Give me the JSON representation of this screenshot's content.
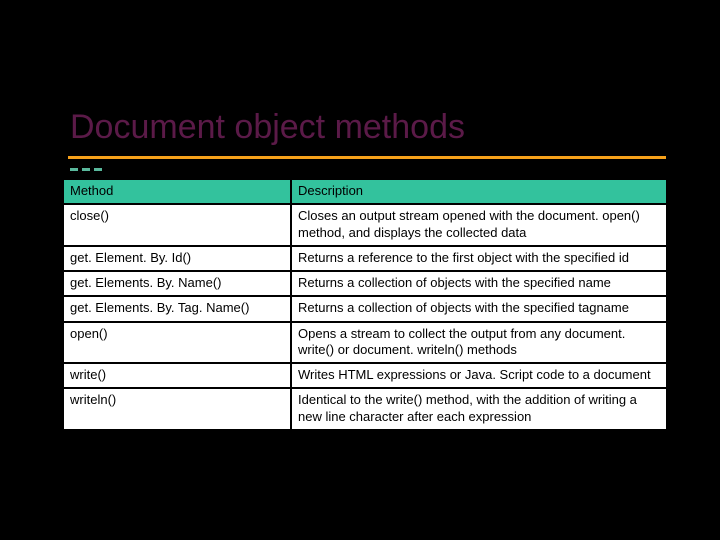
{
  "title": "Document object methods",
  "table": {
    "headers": {
      "method": "Method",
      "description": "Description"
    },
    "rows": [
      {
        "method": "close()",
        "description": "Closes an output stream opened with the document. open() method, and displays the collected data"
      },
      {
        "method": "get. Element. By. Id()",
        "description": "Returns a reference to the first object with the specified id"
      },
      {
        "method": "get. Elements. By. Name()",
        "description": "Returns a collection of objects with the specified name"
      },
      {
        "method": "get. Elements. By. Tag. Name()",
        "description": "Returns a collection of objects with the specified tagname"
      },
      {
        "method": "open()",
        "description": "Opens a stream to collect the output from any document. write() or document. writeln() methods"
      },
      {
        "method": "write()",
        "description": "Writes HTML expressions or Java. Script code to a document"
      },
      {
        "method": "writeln()",
        "description": "Identical to the write() method, with the addition of writing a new line character after each expression"
      }
    ]
  }
}
